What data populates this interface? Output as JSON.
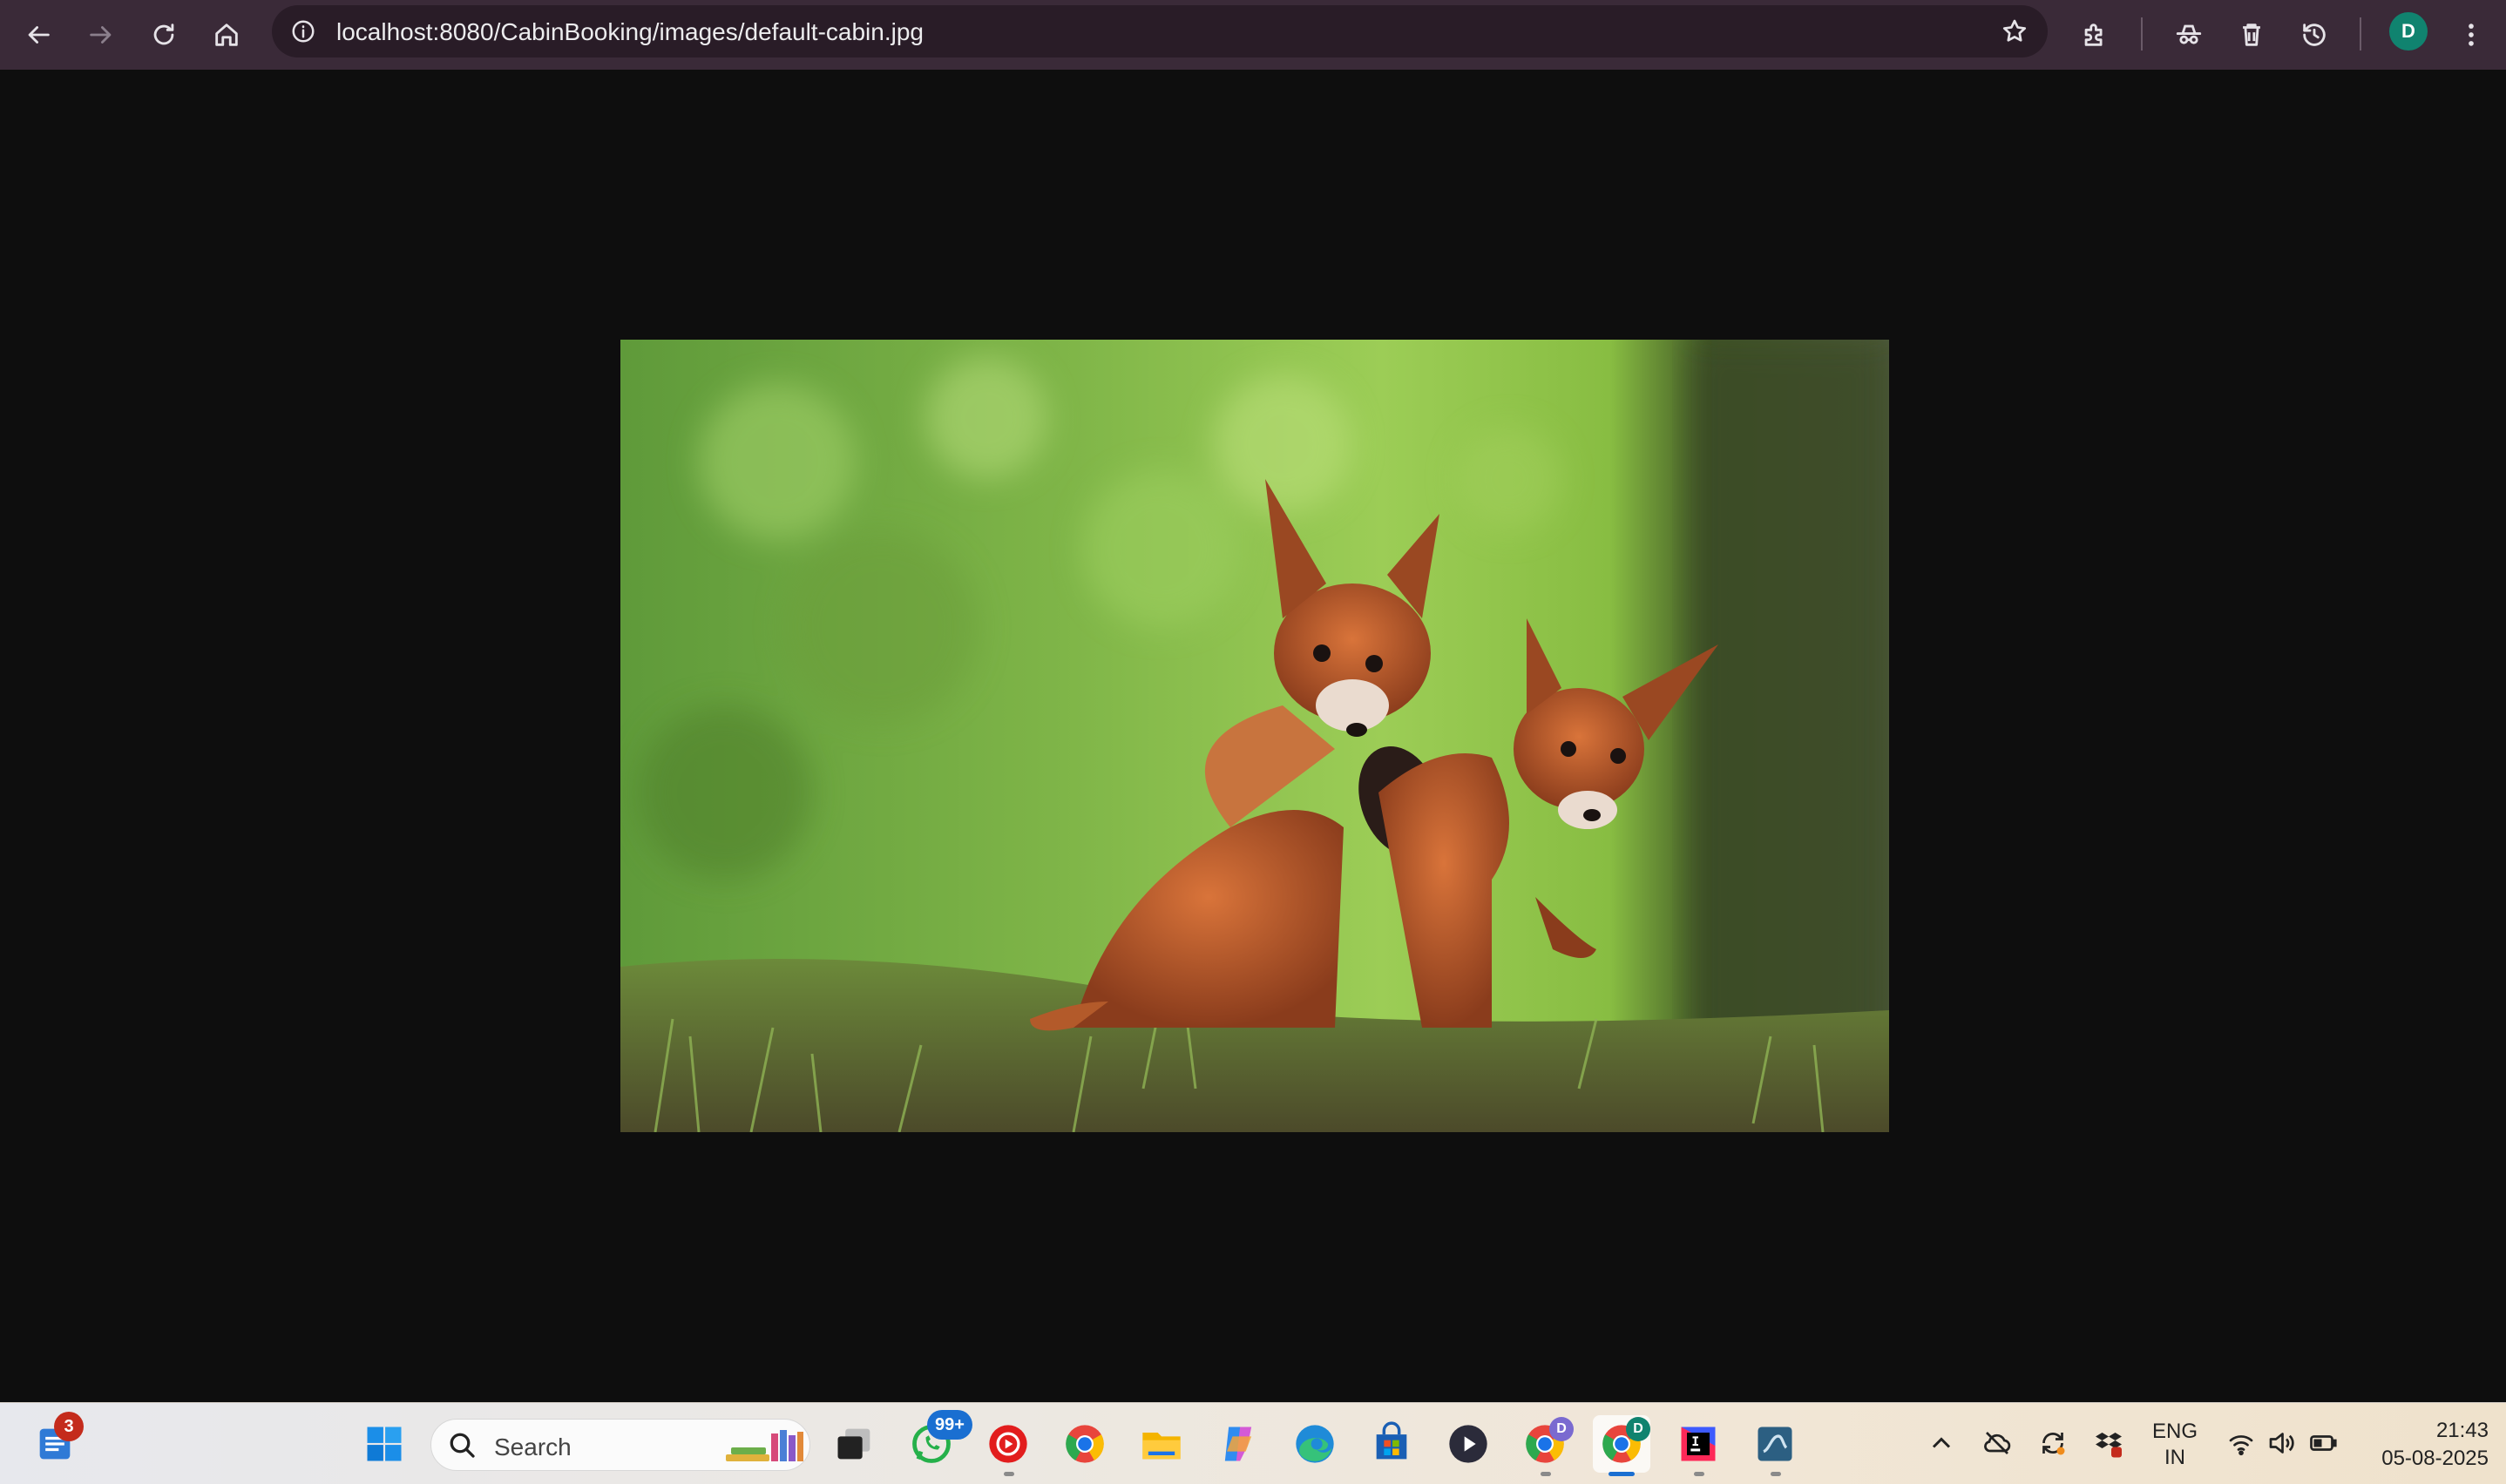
{
  "browser": {
    "url": "localhost:8080/CabinBooking/images/default-cabin.jpg",
    "profile_initial": "D",
    "icons": [
      "back-icon",
      "forward-icon",
      "reload-icon",
      "home-icon",
      "site-info-icon",
      "bookmark-star-icon",
      "extensions-icon",
      "incognito-icon",
      "delete-icon",
      "history-icon",
      "more-menu-icon"
    ]
  },
  "viewer": {
    "background": "#0e0e0e",
    "image_subject": "two fox cubs on grass"
  },
  "taskbar": {
    "widgets_badge": "3",
    "search_placeholder": "Search",
    "whatsapp_badge": "99+",
    "chrome_profile_badge_1": "D",
    "chrome_profile_badge_2": "D",
    "language_line1": "ENG",
    "language_line2": "IN",
    "time": "21:43",
    "date": "05-08-2025",
    "apps": [
      "widgets",
      "start",
      "search",
      "task-view",
      "whatsapp",
      "youtube-music",
      "chrome",
      "file-explorer",
      "copilot",
      "edge",
      "microsoft-store",
      "media-player",
      "chrome-profile",
      "chrome-active",
      "intellij",
      "mysql-workbench"
    ],
    "tray": [
      "show-hidden-icons",
      "onedrive-offline",
      "sync",
      "dropbox",
      "wifi",
      "volume",
      "battery"
    ]
  },
  "colors": {
    "toolbar": "#3a2a38",
    "omnibox": "#291c27",
    "avatar": "#10836f",
    "badge_red": "#c42b1c",
    "badge_blue": "#1a6fd1"
  }
}
